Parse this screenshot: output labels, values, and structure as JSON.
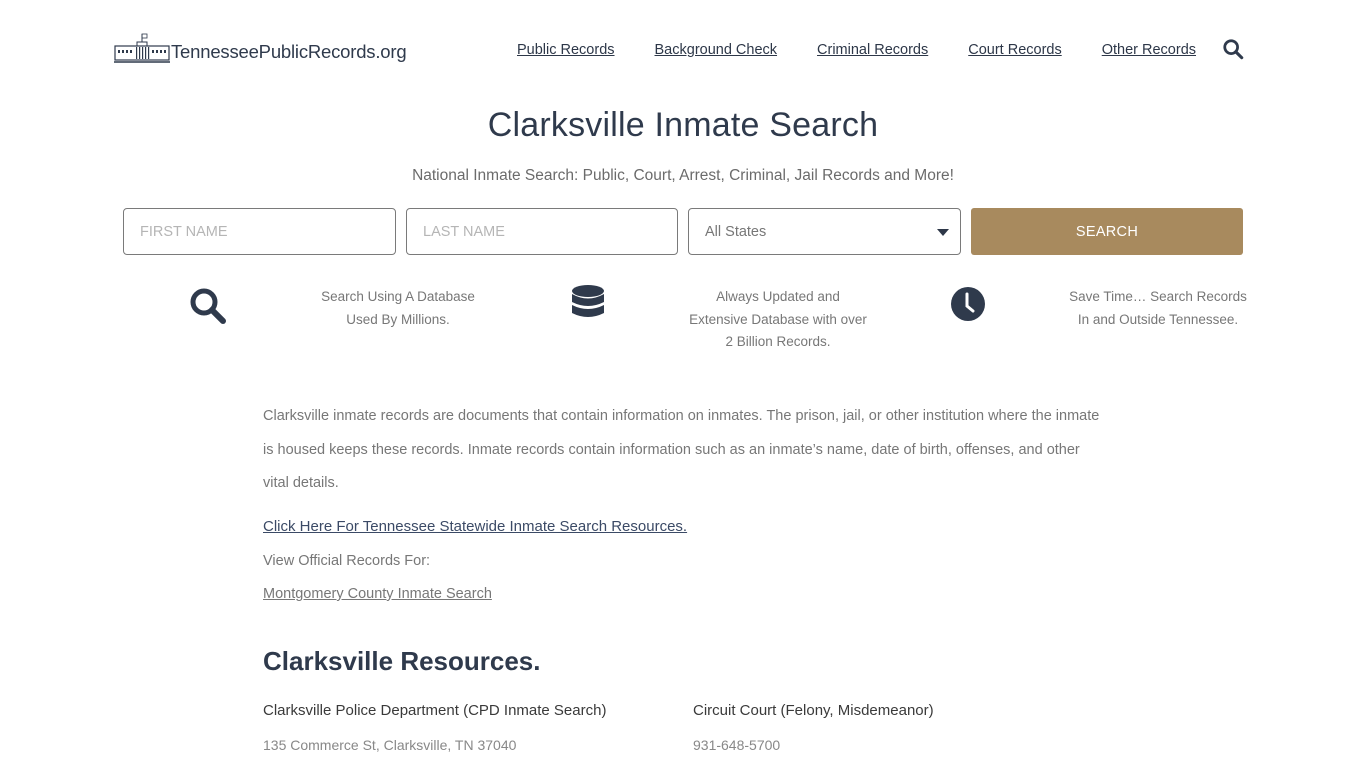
{
  "header": {
    "logo_text": "TennesseePublicRecords.org",
    "logo_icon": "capitol-building-icon",
    "nav": [
      {
        "label": "Public Records"
      },
      {
        "label": "Background Check"
      },
      {
        "label": "Criminal Records"
      },
      {
        "label": "Court Records"
      },
      {
        "label": "Other Records"
      }
    ],
    "search_icon": "search-icon"
  },
  "hero": {
    "title": "Clarksville Inmate Search",
    "subtitle": "National Inmate Search: Public, Court, Arrest, Criminal, Jail Records and More!"
  },
  "search_form": {
    "first_name_placeholder": "FIRST NAME",
    "first_name_value": "",
    "last_name_placeholder": "LAST NAME",
    "last_name_value": "",
    "state_selected": "All States",
    "submit_label": "SEARCH",
    "button_color": "#a88a5e"
  },
  "features": [
    {
      "icon": "search-icon",
      "text": "Search Using A Database Used By Millions."
    },
    {
      "icon": "database-icon",
      "text": "Always Updated and Extensive Database with over 2 Billion Records."
    },
    {
      "icon": "clock-icon",
      "text": "Save Time… Search Records In and Outside Tennessee."
    }
  ],
  "content": {
    "intro": "Clarksville inmate records are documents that contain information on inmates. The prison, jail, or other institution where the inmate is housed keeps these records. Inmate records contain information such as an inmate’s name, date of birth, offenses, and other vital details.",
    "statewide_link": "Click Here For Tennessee Statewide Inmate Search Resources.",
    "view_label": "View Official Records For:",
    "county_link": "Montgomery County Inmate Search",
    "resources_title": "Clarksville Resources.",
    "resources": [
      {
        "name": "Clarksville Police Department (CPD Inmate Search)",
        "detail": "135 Commerce St, Clarksville, TN 37040"
      },
      {
        "name": "Circuit Court (Felony, Misdemeanor)",
        "detail": "931-648-5700"
      }
    ]
  },
  "colors": {
    "text_dark": "#2f3a4c",
    "accent": "#a88a5e",
    "muted": "#777777"
  }
}
